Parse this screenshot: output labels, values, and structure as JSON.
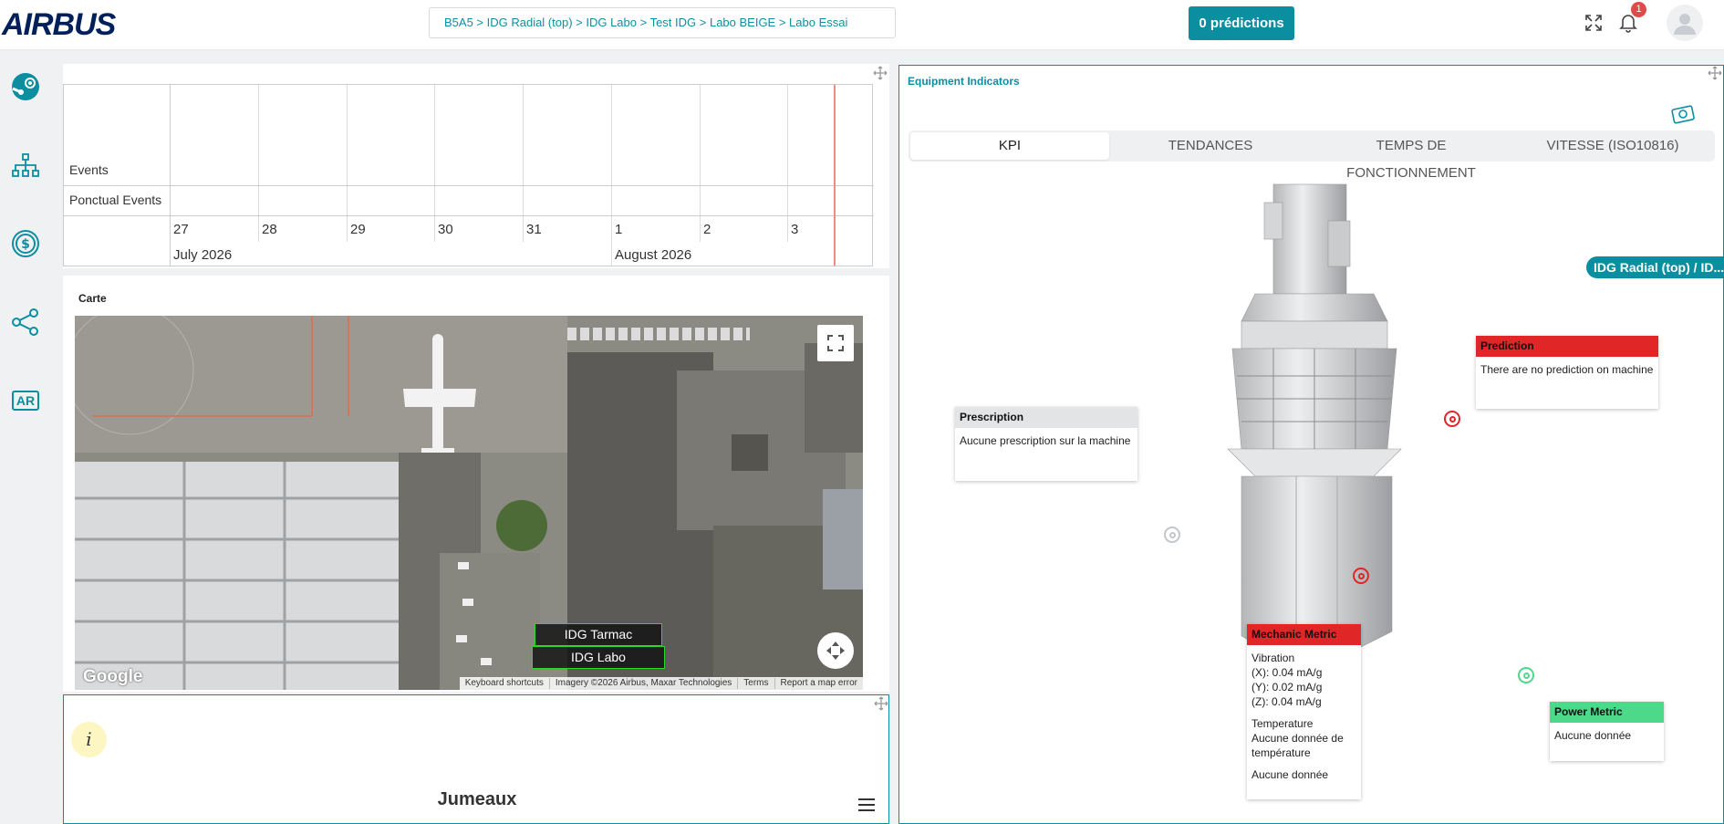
{
  "header": {
    "logo": "AIRBUS",
    "breadcrumb": "B5A5 > IDG Radial (top) > IDG Labo > Test IDG > Labo BEIGE > Labo Essai",
    "predictions_button": "0 prédictions",
    "notification_count": "1"
  },
  "sidebar": {
    "items": [
      "steam-icon",
      "hierarchy-icon",
      "dollar-icon",
      "share-icon",
      "ar-icon"
    ],
    "ar_label": "AR"
  },
  "timeline": {
    "rows": [
      "Events",
      "Ponctual Events"
    ],
    "days": [
      "27",
      "28",
      "29",
      "30",
      "31",
      "1",
      "2",
      "3"
    ],
    "months": [
      "July 2026",
      "August 2026"
    ]
  },
  "map": {
    "title": "Carte",
    "labels": [
      "IDG Tarmac",
      "IDG Labo"
    ],
    "google": "Google",
    "footer": [
      "Keyboard shortcuts",
      "Imagery ©2026 Airbus, Maxar Technologies",
      "Terms",
      "Report a map error"
    ]
  },
  "twins": {
    "info": "i",
    "title": "Jumeaux"
  },
  "equipment": {
    "title": "Equipment Indicators",
    "tabs": [
      "KPI",
      "TENDANCES",
      "TEMPS DE FONCTIONNEMENT",
      "VITESSE (ISO10816)"
    ],
    "active_tab": "KPI",
    "chip": "IDG Radial (top) / ID...",
    "prediction": {
      "title": "Prediction",
      "text": "There are no prediction on machine"
    },
    "prescription": {
      "title": "Prescription",
      "text": "Aucune prescription sur la machine"
    },
    "mechanic": {
      "title": "Mechanic Metric",
      "vibration_label": "Vibration",
      "x": "(X): 0.04 mA/g",
      "y": "(Y): 0.02 mA/g",
      "z": "(Z): 0.04 mA/g",
      "temperature_label": "Temperature",
      "temperature_value": "Aucune donnée de température",
      "other": "Aucune donnée"
    },
    "power": {
      "title": "Power Metric",
      "text": "Aucune donnée"
    },
    "colors": {
      "red": "#e02626",
      "green": "#4dd98a",
      "accent": "#0b8fa0"
    }
  }
}
